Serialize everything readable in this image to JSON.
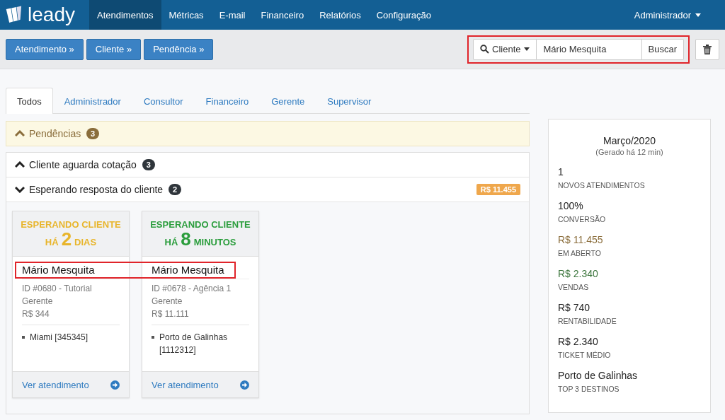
{
  "navbar": {
    "brand": "leady",
    "items": [
      {
        "label": "Atendimentos",
        "selected": true
      },
      {
        "label": "Métricas",
        "selected": false
      },
      {
        "label": "E-mail",
        "selected": false
      },
      {
        "label": "Financeiro",
        "selected": false
      },
      {
        "label": "Relatórios",
        "selected": false
      },
      {
        "label": "Configuração",
        "selected": false
      }
    ],
    "user": "Administrador"
  },
  "toolbar": {
    "buttons": [
      "Atendimento »",
      "Cliente »",
      "Pendência »"
    ],
    "search": {
      "highlighted": true,
      "filter": "Cliente",
      "value": "Mário Mesquita",
      "button": "Buscar"
    }
  },
  "tabs": [
    {
      "label": "Todos",
      "selected": true
    },
    {
      "label": "Administrador",
      "selected": false
    },
    {
      "label": "Consultor",
      "selected": false
    },
    {
      "label": "Financeiro",
      "selected": false
    },
    {
      "label": "Gerente",
      "selected": false
    },
    {
      "label": "Supervisor",
      "selected": false
    }
  ],
  "pendencias": {
    "title": "Pendências",
    "count": "3",
    "expanded": false
  },
  "groups": [
    {
      "title": "Cliente aguarda cotação",
      "count": "3",
      "expanded": false
    },
    {
      "title": "Esperando resposta do cliente",
      "count": "2",
      "expanded": true,
      "names_highlighted": true,
      "total": "R$ 11.455",
      "cards": [
        {
          "status": "ESPERANDO CLIENTE",
          "prefix": "HÁ",
          "number": "2",
          "unit": "DIAS",
          "color": "#e8b52b",
          "name": "Mário Mesquita",
          "details": [
            "ID #0680 - Tutorial",
            "Gerente",
            "R$ 344"
          ],
          "destinations": [
            "Miami [345345]"
          ],
          "link": "Ver atendimento"
        },
        {
          "status": "ESPERANDO CLIENTE",
          "prefix": "HÁ",
          "number": "8",
          "unit": "MINUTOS",
          "color": "#2a9d3c",
          "name": "Mário Mesquita",
          "details": [
            "ID #0678 - Agência 1",
            "Gerente",
            "R$ 11.111"
          ],
          "destinations": [
            "Porto de Galinhas [1112312]"
          ],
          "link": "Ver atendimento"
        }
      ]
    }
  ],
  "stats": {
    "title": "Março/2020",
    "subtitle": "(Gerado há 12 min)",
    "items": [
      {
        "value": "1",
        "label": "NOVOS ATENDIMENTOS",
        "color": "#222222"
      },
      {
        "value": "100%",
        "label": "CONVERSÃO",
        "color": "#222222"
      },
      {
        "value": "R$ 11.455",
        "label": "EM ABERTO",
        "color": "#8a6d3b"
      },
      {
        "value": "R$ 2.340",
        "label": "VENDAS",
        "color": "#3c763d"
      },
      {
        "value": "R$ 740",
        "label": "RENTABILIDADE",
        "color": "#222222"
      },
      {
        "value": "R$ 2.340",
        "label": "TICKET MÉDIO",
        "color": "#222222"
      },
      {
        "value": "Porto de Galinhas",
        "label": "TOP 3 DESTINOS",
        "color": "#222222"
      }
    ]
  }
}
